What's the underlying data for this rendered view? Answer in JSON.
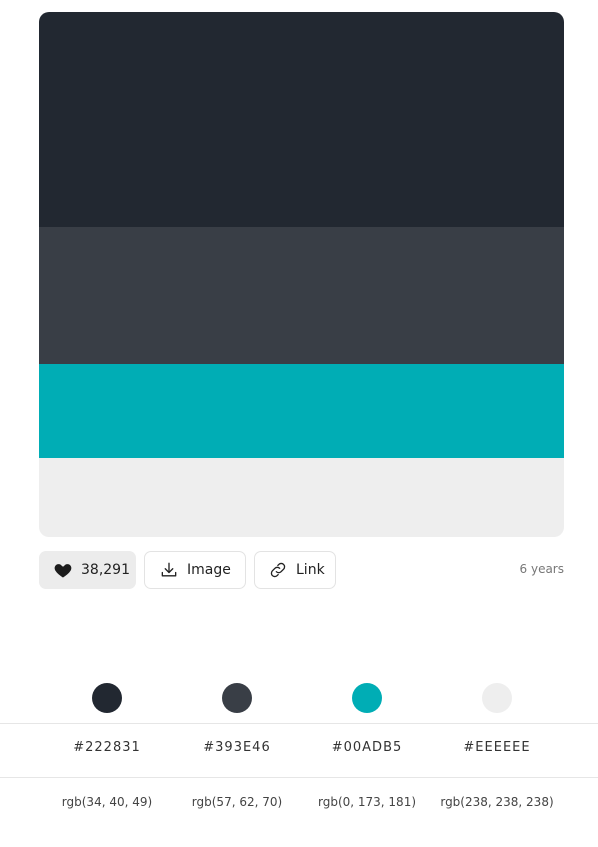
{
  "palette": {
    "colors": [
      {
        "hex": "#222831",
        "rgb": "rgb(34, 40, 49)"
      },
      {
        "hex": "#393E46",
        "rgb": "rgb(57, 62, 70)"
      },
      {
        "hex": "#00ADB5",
        "rgb": "rgb(0, 173, 181)"
      },
      {
        "hex": "#EEEEEE",
        "rgb": "rgb(238, 238, 238)"
      }
    ]
  },
  "actions": {
    "likes": "38,291",
    "image_label": "Image",
    "link_label": "Link",
    "age": "6 years",
    "icons": {
      "like": "heart-icon",
      "image": "download-icon",
      "link": "link-icon"
    }
  }
}
